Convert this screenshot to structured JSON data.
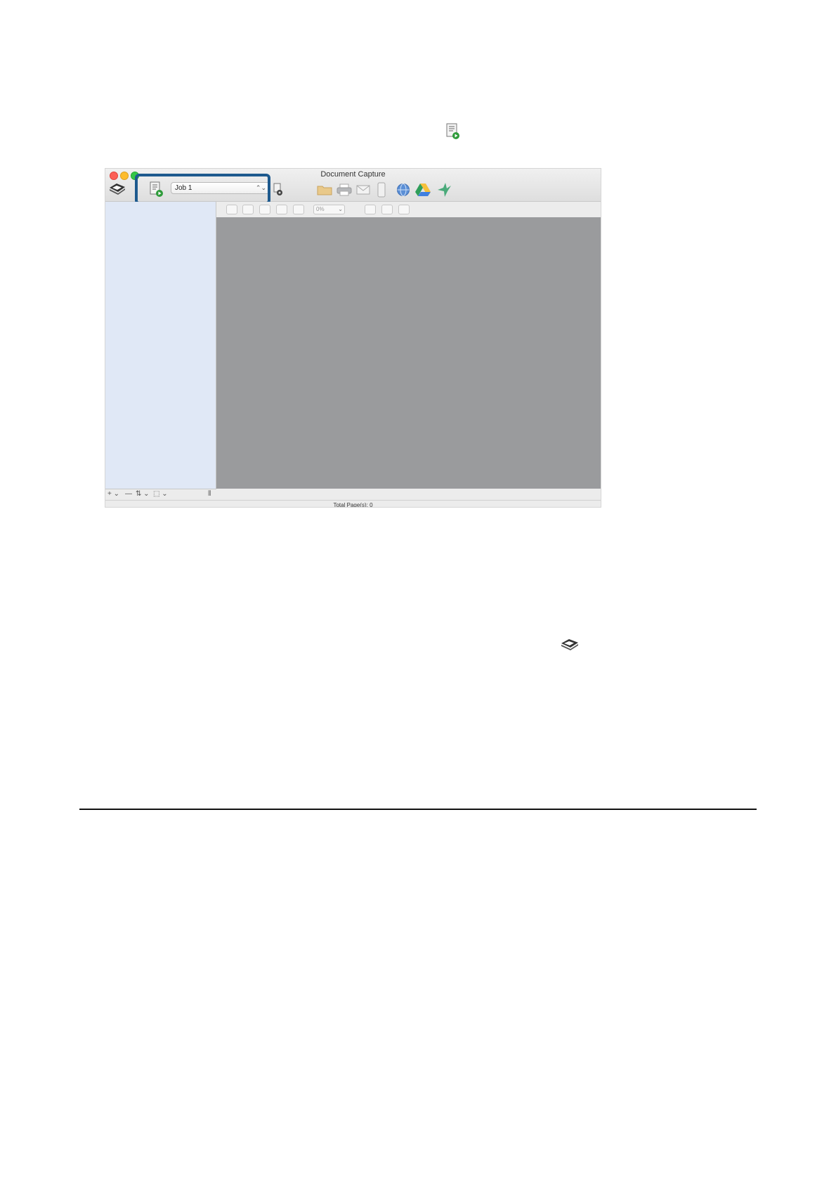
{
  "window": {
    "title": "Document Capture",
    "job_value": "Job 1",
    "zoom_value": "0%",
    "status_text": "Total Page(s): 0"
  },
  "icons": {
    "doc_inline_1": "scan-job-icon",
    "doc_inline_2": "scanner-icon"
  },
  "colors": {
    "highlight_border": "#1e5a8e",
    "left_pane": "#e0e8f6",
    "preview": "#9a9b9d"
  }
}
